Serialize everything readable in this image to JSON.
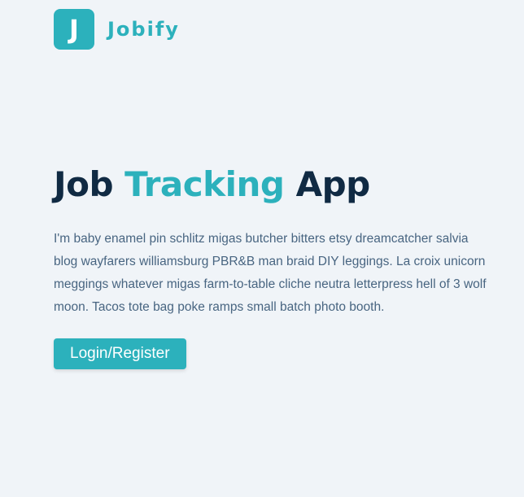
{
  "brand": {
    "logo_letter": "J",
    "name": "Jobify",
    "color": "#2cb1bc"
  },
  "hero": {
    "title_part1": "Job ",
    "title_accent": "Tracking",
    "title_part2": " App",
    "description": "I'm baby enamel pin schlitz migas butcher bitters etsy dreamcatcher salvia blog wayfarers williamsburg PBR&B man braid DIY leggings. La croix unicorn meggings whatever migas farm-to-table cliche neutra letterpress hell of 3 wolf moon. Tacos tote bag poke ramps small batch photo booth.",
    "cta_label": "Login/Register"
  },
  "colors": {
    "background": "#f0f4f8",
    "heading": "#102a43",
    "body_text": "#486581",
    "accent": "#2cb1bc"
  }
}
